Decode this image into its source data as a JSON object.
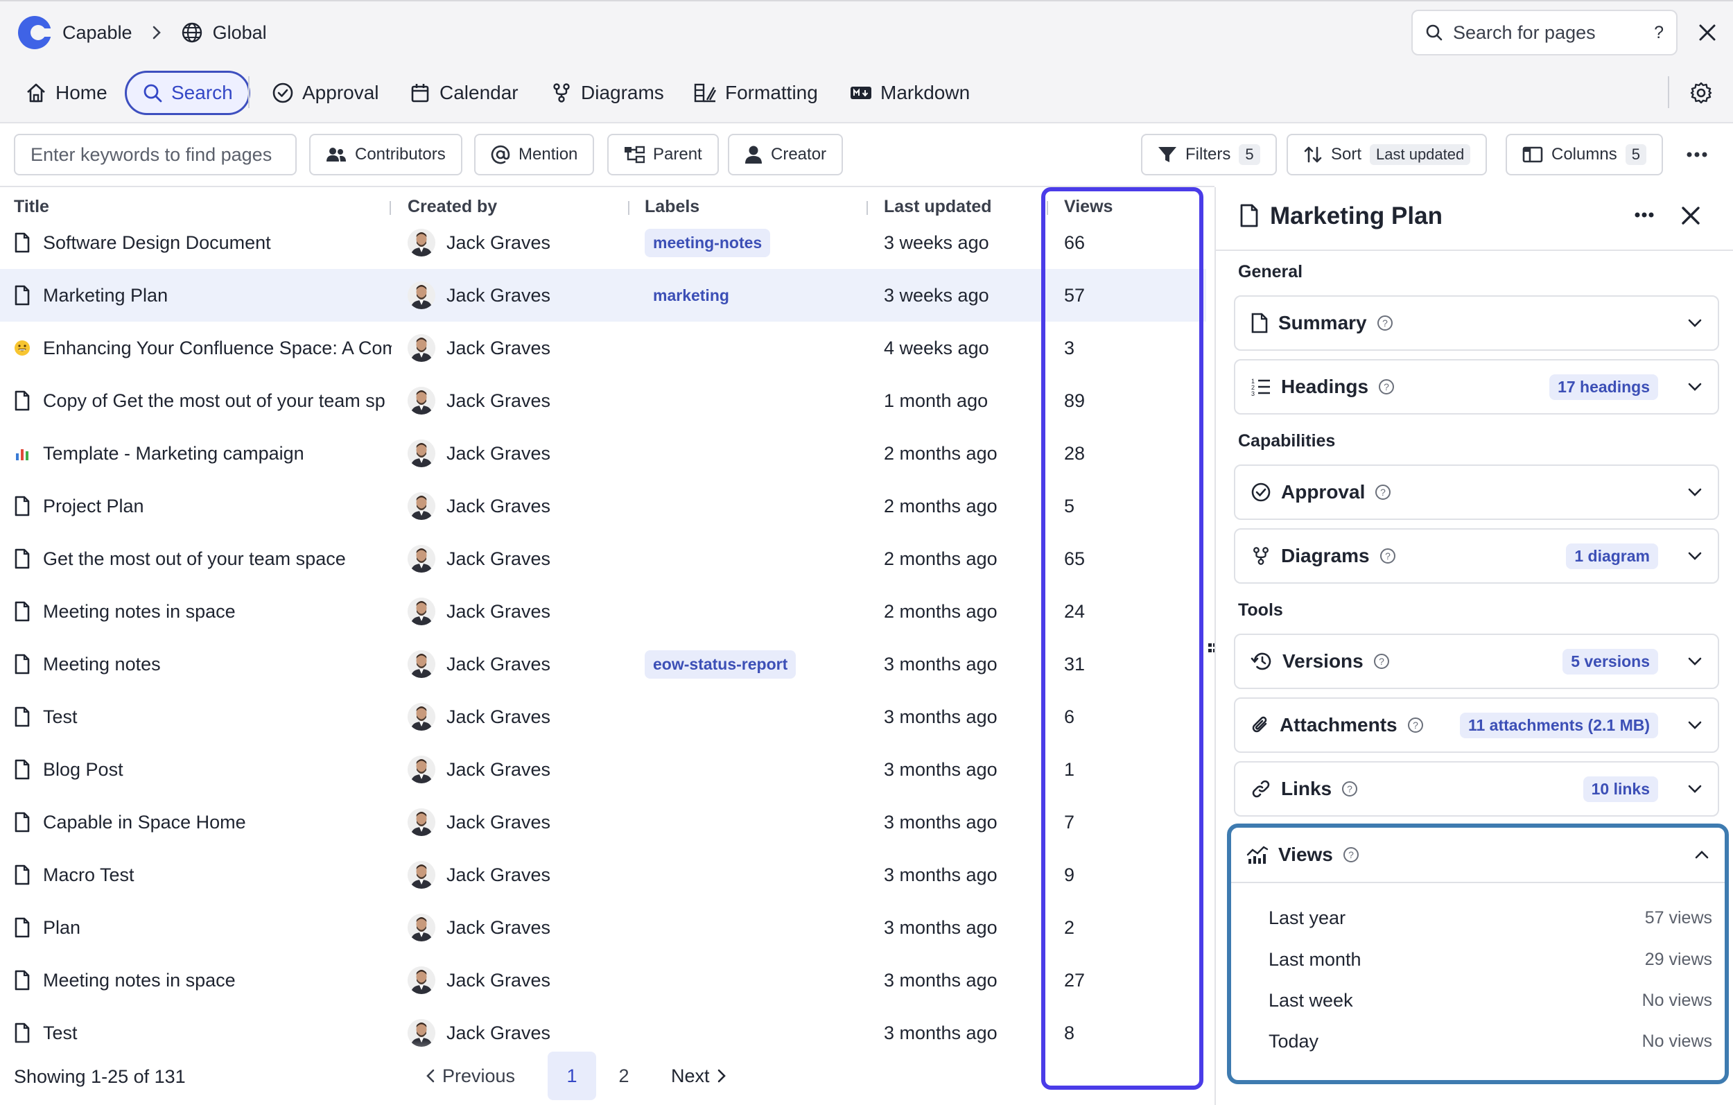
{
  "breadcrumb": {
    "app": "Capable",
    "space": "Global"
  },
  "search_pages": {
    "placeholder": "Search for pages",
    "help": "?"
  },
  "nav": {
    "items": [
      {
        "label": "Home",
        "icon": "home-icon"
      },
      {
        "label": "Search",
        "icon": "search-icon",
        "active": true
      },
      {
        "label": "Approval",
        "icon": "check-circle-icon"
      },
      {
        "label": "Calendar",
        "icon": "calendar-icon"
      },
      {
        "label": "Diagrams",
        "icon": "diagram-icon"
      },
      {
        "label": "Formatting",
        "icon": "formatting-icon"
      },
      {
        "label": "Markdown",
        "icon": "markdown-icon"
      }
    ]
  },
  "filters": {
    "keywords_placeholder": "Enter keywords to find pages",
    "contributors": "Contributors",
    "mention": "Mention",
    "parent": "Parent",
    "creator": "Creator",
    "filters_label": "Filters",
    "filters_count": "5",
    "sort_label": "Sort",
    "sort_value": "Last updated",
    "columns_label": "Columns",
    "columns_count": "5"
  },
  "table": {
    "headers": {
      "title": "Title",
      "created_by": "Created by",
      "labels": "Labels",
      "last_updated": "Last updated",
      "views": "Views"
    },
    "rows": [
      {
        "icon": "page-icon",
        "title": "Software Design Document",
        "creator": "Jack Graves",
        "label": "meeting-notes",
        "updated": "3 weeks ago",
        "views": "66"
      },
      {
        "icon": "page-icon",
        "title": "Marketing Plan",
        "creator": "Jack Graves",
        "label": "marketing",
        "updated": "3 weeks ago",
        "views": "57",
        "selected": true
      },
      {
        "icon": "emoji-grin-icon",
        "title": "Enhancing Your Confluence Space: A Com",
        "creator": "Jack Graves",
        "label": "",
        "updated": "4 weeks ago",
        "views": "3"
      },
      {
        "icon": "page-icon",
        "title": "Copy of Get the most out of your team sp",
        "creator": "Jack Graves",
        "label": "",
        "updated": "1 month ago",
        "views": "89"
      },
      {
        "icon": "bar-chart-icon",
        "title": "Template - Marketing campaign",
        "creator": "Jack Graves",
        "label": "",
        "updated": "2 months ago",
        "views": "28"
      },
      {
        "icon": "page-icon",
        "title": "Project Plan",
        "creator": "Jack Graves",
        "label": "",
        "updated": "2 months ago",
        "views": "5"
      },
      {
        "icon": "page-icon",
        "title": "Get the most out of your team space",
        "creator": "Jack Graves",
        "label": "",
        "updated": "2 months ago",
        "views": "65"
      },
      {
        "icon": "page-icon",
        "title": "Meeting notes in space",
        "creator": "Jack Graves",
        "label": "",
        "updated": "2 months ago",
        "views": "24"
      },
      {
        "icon": "page-icon",
        "title": "Meeting notes",
        "creator": "Jack Graves",
        "label": "eow-status-report",
        "updated": "3 months ago",
        "views": "31"
      },
      {
        "icon": "page-icon",
        "title": "Test",
        "creator": "Jack Graves",
        "label": "",
        "updated": "3 months ago",
        "views": "6"
      },
      {
        "icon": "page-icon",
        "title": "Blog Post",
        "creator": "Jack Graves",
        "label": "",
        "updated": "3 months ago",
        "views": "1"
      },
      {
        "icon": "page-icon",
        "title": "Capable in Space Home",
        "creator": "Jack Graves",
        "label": "",
        "updated": "3 months ago",
        "views": "7"
      },
      {
        "icon": "page-icon",
        "title": "Macro Test",
        "creator": "Jack Graves",
        "label": "",
        "updated": "3 months ago",
        "views": "9"
      },
      {
        "icon": "page-icon",
        "title": "Plan",
        "creator": "Jack Graves",
        "label": "",
        "updated": "3 months ago",
        "views": "2"
      },
      {
        "icon": "page-icon",
        "title": "Meeting notes in space",
        "creator": "Jack Graves",
        "label": "",
        "updated": "3 months ago",
        "views": "27"
      },
      {
        "icon": "page-icon",
        "title": "Test",
        "creator": "Jack Graves",
        "label": "",
        "updated": "3 months ago",
        "views": "8"
      }
    ]
  },
  "pagination": {
    "showing": "Showing 1-25 of 131",
    "previous": "Previous",
    "page1": "1",
    "page2": "2",
    "next": "Next"
  },
  "panel": {
    "title": "Marketing Plan",
    "sections": {
      "general": "General",
      "capabilities": "Capabilities",
      "tools": "Tools"
    },
    "summary": "Summary",
    "headings": "Headings",
    "headings_count": "17 headings",
    "approval": "Approval",
    "diagrams": "Diagrams",
    "diagrams_count": "1 diagram",
    "versions": "Versions",
    "versions_count": "5 versions",
    "attachments": "Attachments",
    "attachments_count": "11 attachments (2.1 MB)",
    "links": "Links",
    "links_count": "10 links",
    "views": "Views",
    "view_stats": [
      {
        "period": "Last year",
        "value": "57 views"
      },
      {
        "period": "Last month",
        "value": "29 views"
      },
      {
        "period": "Last week",
        "value": "No views"
      },
      {
        "period": "Today",
        "value": "No views"
      }
    ]
  },
  "colors": {
    "accent": "#3447c6",
    "views_highlight": "#4a3ce8",
    "panel_highlight": "#3e7bb0",
    "label_chip_bg": "#e8ecfb"
  }
}
